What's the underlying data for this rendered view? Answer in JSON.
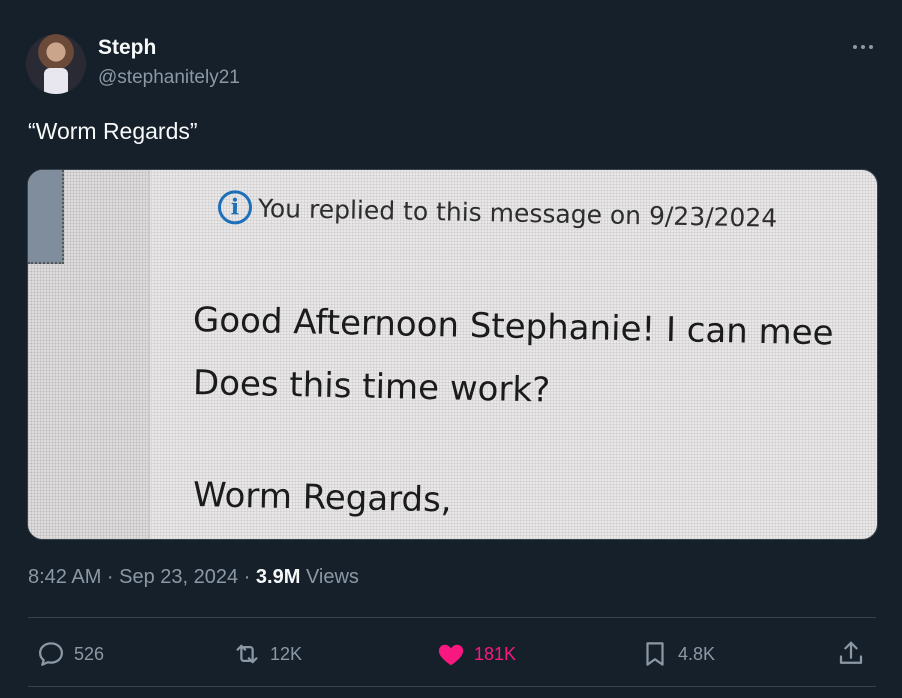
{
  "author": {
    "display_name": "Steph",
    "handle": "@stephanitely21"
  },
  "tweet": {
    "text": "“Worm Regards”",
    "timestamp": "8:42 AM · Sep 23, 2024 · ",
    "views_count": "3.9M",
    "views_label": " Views"
  },
  "media": {
    "info_text": "You replied to this message on 9/23/2024",
    "line1": "Good Afternoon Stephanie! I can mee",
    "line2": "Does this time work?",
    "line3": "Worm Regards,"
  },
  "actions": {
    "replies": "526",
    "reposts": "12K",
    "likes": "181K",
    "bookmarks": "4.8K"
  },
  "colors": {
    "background": "#15202b",
    "like_active": "#f91880",
    "secondary_text": "#8b98a5",
    "divider": "#38444d"
  },
  "icons": [
    "avatar",
    "more-icon",
    "info-icon",
    "reply-icon",
    "retweet-icon",
    "heart-icon",
    "bookmark-icon",
    "share-icon"
  ]
}
